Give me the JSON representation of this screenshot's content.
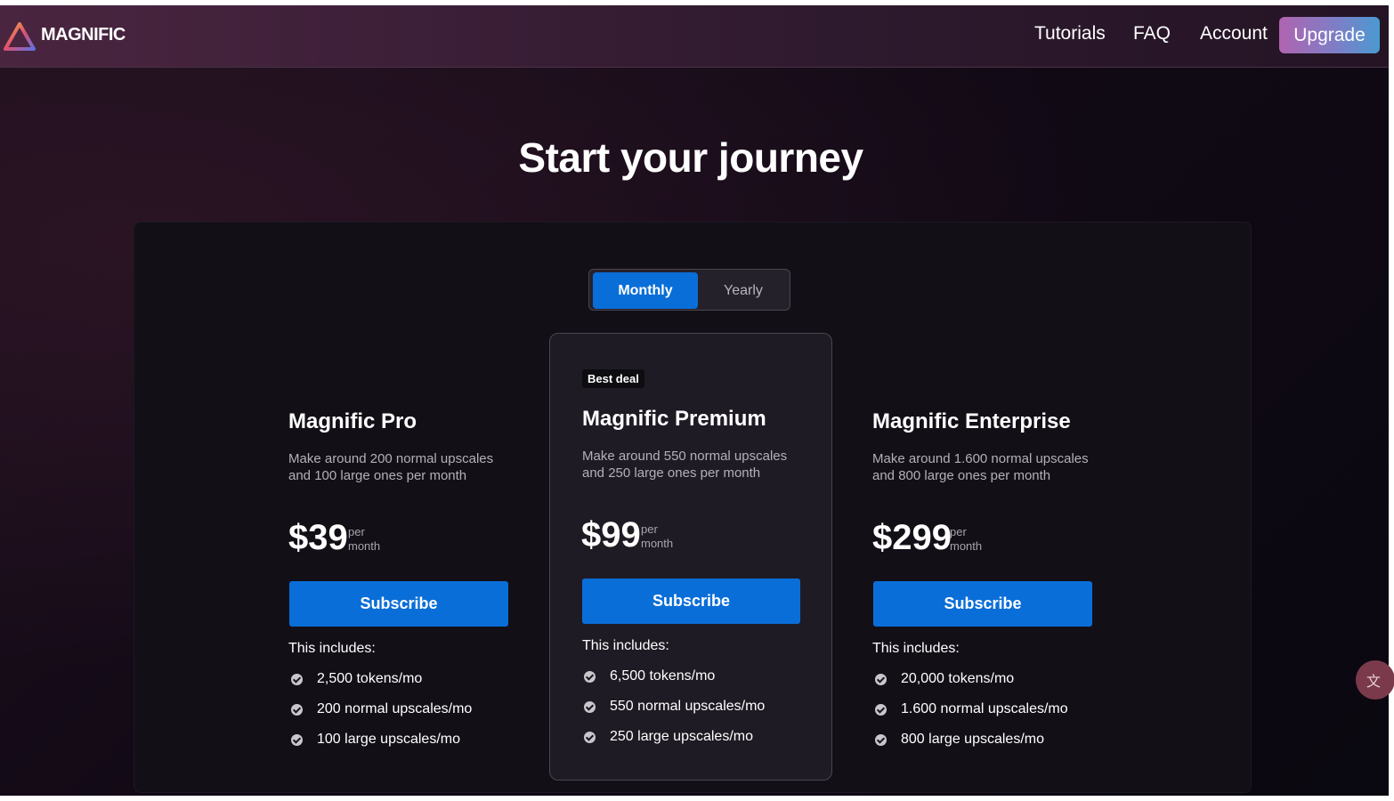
{
  "nav": {
    "brand": "MAGNIFIC",
    "links": [
      "Tutorials",
      "FAQ",
      "Account"
    ],
    "upgrade_label": "Upgrade"
  },
  "hero": {
    "title": "Start your journey"
  },
  "billing_toggle": {
    "options": [
      "Monthly",
      "Yearly"
    ],
    "selected": "Monthly"
  },
  "plans": [
    {
      "name": "Magnific Pro",
      "description": "Make around 200 normal upscales and 100 large ones per month",
      "price": "$39",
      "per_1": "per",
      "per_2": "month",
      "cta": "Subscribe",
      "includes_label": "This includes:",
      "features": [
        "2,500 tokens/mo",
        "200 normal upscales/mo",
        "100 large upscales/mo"
      ]
    },
    {
      "badge": "Best deal",
      "name": "Magnific Premium",
      "description": "Make around 550 normal upscales and 250 large ones per month",
      "price": "$99",
      "per_1": "per",
      "per_2": "month",
      "cta": "Subscribe",
      "includes_label": "This includes:",
      "features": [
        "6,500 tokens/mo",
        "550 normal upscales/mo",
        "250 large upscales/mo"
      ]
    },
    {
      "name": "Magnific Enterprise",
      "description": "Make around 1.600 normal upscales and 800 large ones per month",
      "price": "$299",
      "per_1": "per",
      "per_2": "month",
      "cta": "Subscribe",
      "includes_label": "This includes:",
      "features": [
        "20,000 tokens/mo",
        "1.600 normal upscales/mo",
        "800 large upscales/mo"
      ]
    }
  ],
  "colors": {
    "accent": "#0a6ed8",
    "background": "#120a16",
    "panel": "#130f17",
    "highlight_card": "#1f1b24"
  },
  "icons": {
    "logo": "triangle-logo-icon",
    "check": "check-circle-icon",
    "translate": "translate-icon"
  }
}
